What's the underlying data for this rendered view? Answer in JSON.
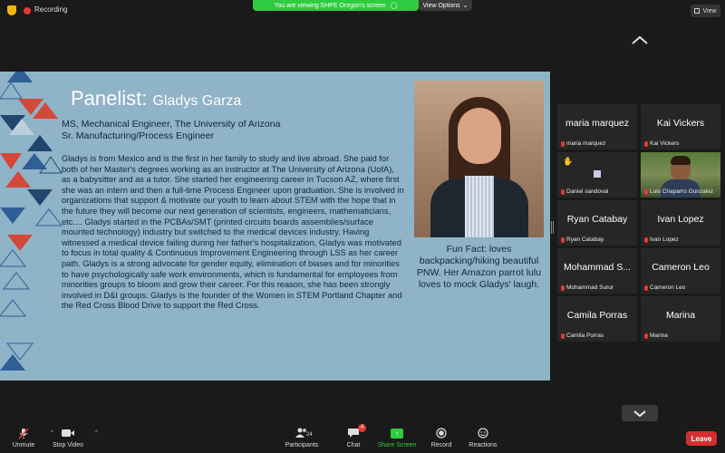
{
  "top": {
    "recording_label": "Recording",
    "share_banner": "You are viewing SHPE Oregon's screen",
    "view_options_label": "View Options",
    "view_button_label": "View"
  },
  "slide": {
    "title_prefix": "Panelist:",
    "title_name": "Gladys Garza",
    "degree_line1": "MS, Mechanical  Engineer, The University of Arizona",
    "degree_line2": "Sr. Manufacturing/Process Engineer",
    "bio": "Gladys is from Mexico and is the first in her family to study and live abroad. She paid for both of her Master's degrees working as an instructor at The University of Arizona (UofA), as a babysitter and as a tutor. She started her engineering career in Tucson AZ, where first she was an intern and then a full-time Process Engineer upon graduation. She is  involved in organizations that support & motivate our youth to learn about STEM with the hope that in the future they will become our next generation of scientists, engineers, mathematicians, etc.... Gladys started in the PCBAs/SMT (printed circuits boards assemblies/surface mounted technology) industry but switched to the medical devices industry. Having witnessed a medical device failing during her father's hospitalization, Gladys was motivated to focus in  total quality & Continuous Improvement Engineering through LSS as her career path. Gladys is a strong advocate for gender equity, elimination of biases and for minorities to have psychologically safe work environments, which is fundamental for employees from minorities groups to bloom and grow their career. For this reason, she has been strongly involved in D&I groups. Gladys is the founder of the Women in STEM Portland Chapter and the Red Cross Blood Drive to support the Red Cross.",
    "fun_fact": "Fun Fact: loves backpacking/hiking beautiful PNW. Her Amazon parrot lulu loves to mock Gladys' laugh."
  },
  "gallery": {
    "tiles": [
      {
        "display": "maria marquez",
        "label": "maria marquez",
        "kind": "name"
      },
      {
        "display": "Kai Vickers",
        "label": "Kai Vickers",
        "kind": "name"
      },
      {
        "display": "",
        "label": "Daniel sandoval",
        "kind": "reaction"
      },
      {
        "display": "",
        "label": "Luis Chaparro Gonzalez",
        "kind": "video"
      },
      {
        "display": "Ryan Catabay",
        "label": "Ryan Catabay",
        "kind": "name"
      },
      {
        "display": "Ivan Lopez",
        "label": "Ivan Lopez",
        "kind": "name"
      },
      {
        "display": "Mohammad S...",
        "label": "Mohammad Surur",
        "kind": "name"
      },
      {
        "display": "Cameron Leo",
        "label": "Cameron Leo",
        "kind": "name"
      },
      {
        "display": "Camila Porras",
        "label": "Camila Porras",
        "kind": "name"
      },
      {
        "display": "Marina",
        "label": "Marina",
        "kind": "name"
      }
    ]
  },
  "toolbar": {
    "unmute": "Unmute",
    "stop_video": "Stop Video",
    "participants": "Participants",
    "participants_count": "24",
    "chat": "Chat",
    "chat_badge": "4",
    "share_screen": "Share Screen",
    "record": "Record",
    "reactions": "Reactions",
    "leave": "Leave"
  },
  "colors": {
    "slide_bg": "#8fb3c7",
    "share_green": "#2ecc40",
    "leave_red": "#d32f2f",
    "record_red": "#e53935"
  }
}
